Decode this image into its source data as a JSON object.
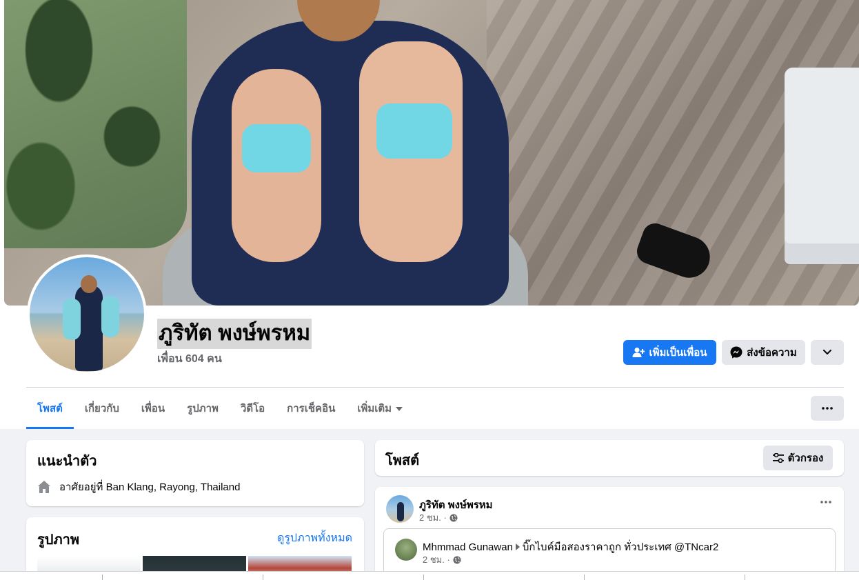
{
  "profile": {
    "name": "ภูริทัต พงษ์พรหม",
    "friends": "เพื่อน 604 คน"
  },
  "actions": {
    "add_friend": "เพิ่มเป็นเพื่อน",
    "message": "ส่งข้อความ",
    "more_icon": "chevron-down-icon"
  },
  "tabs": [
    {
      "label": "โพสต์",
      "active": true
    },
    {
      "label": "เกี่ยวกับ"
    },
    {
      "label": "เพื่อน"
    },
    {
      "label": "รูปภาพ"
    },
    {
      "label": "วิดีโอ"
    },
    {
      "label": "การเช็คอิน"
    },
    {
      "label": "เพิ่มเติม"
    }
  ],
  "intro": {
    "title": "แนะนำตัว",
    "lives_in": "อาศัยอยู่ที่ Ban Klang, Rayong, Thailand"
  },
  "photos": {
    "title": "รูปภาพ",
    "see_all": "ดูรูปภาพทั้งหมด"
  },
  "posts": {
    "title": "โพสต์",
    "filter": "ตัวกรอง",
    "items": [
      {
        "author": "ภูริทัต พงษ์พรหม",
        "time": "2 ชม. ·",
        "shared": {
          "author": "Mhmmad Gunawan",
          "group": "บิ๊กไบค์มือสองราคาถูก ทั่วประเทศ @TNcar2",
          "time": "2 ชม. ·"
        }
      }
    ]
  },
  "colors": {
    "accent": "#1877f2",
    "background": "#f0f2f5",
    "secondary_button": "#e4e6eb",
    "muted_text": "#65676b"
  }
}
